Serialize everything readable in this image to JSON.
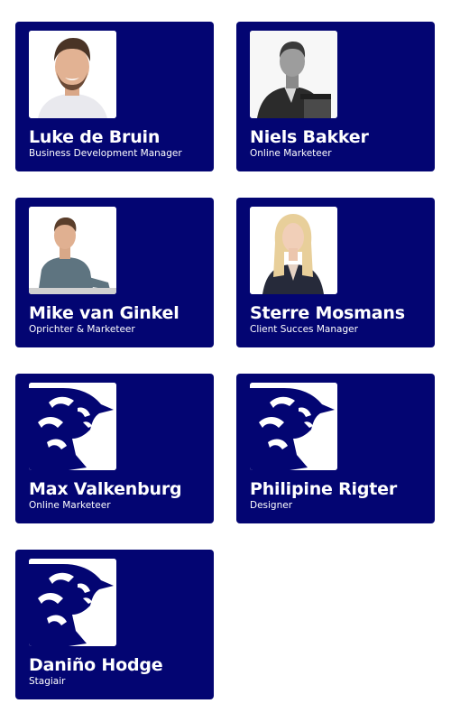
{
  "team": [
    {
      "name": "Luke de Bruin",
      "role": "Business Development Manager",
      "photo": "portrait-smiling-man"
    },
    {
      "name": "Niels Bakker",
      "role": "Online Marketeer",
      "photo": "portrait-man-suit-grayscale"
    },
    {
      "name": "Mike van Ginkel",
      "role": "Oprichter & Marketeer",
      "photo": "portrait-man-at-desk"
    },
    {
      "name": "Sterre Mosmans",
      "role": "Client Succes Manager",
      "photo": "portrait-blonde-woman"
    },
    {
      "name": "Max Valkenburg",
      "role": "Online Marketeer",
      "photo": "bull-logo-icon"
    },
    {
      "name": "Philipine Rigter",
      "role": "Designer",
      "photo": "bull-logo-icon"
    },
    {
      "name": "Daniño Hodge",
      "role": "Stagiair",
      "photo": "bull-logo-icon"
    }
  ],
  "colors": {
    "card_background": "#030572",
    "text": "#ffffff",
    "logo": "#030572"
  }
}
